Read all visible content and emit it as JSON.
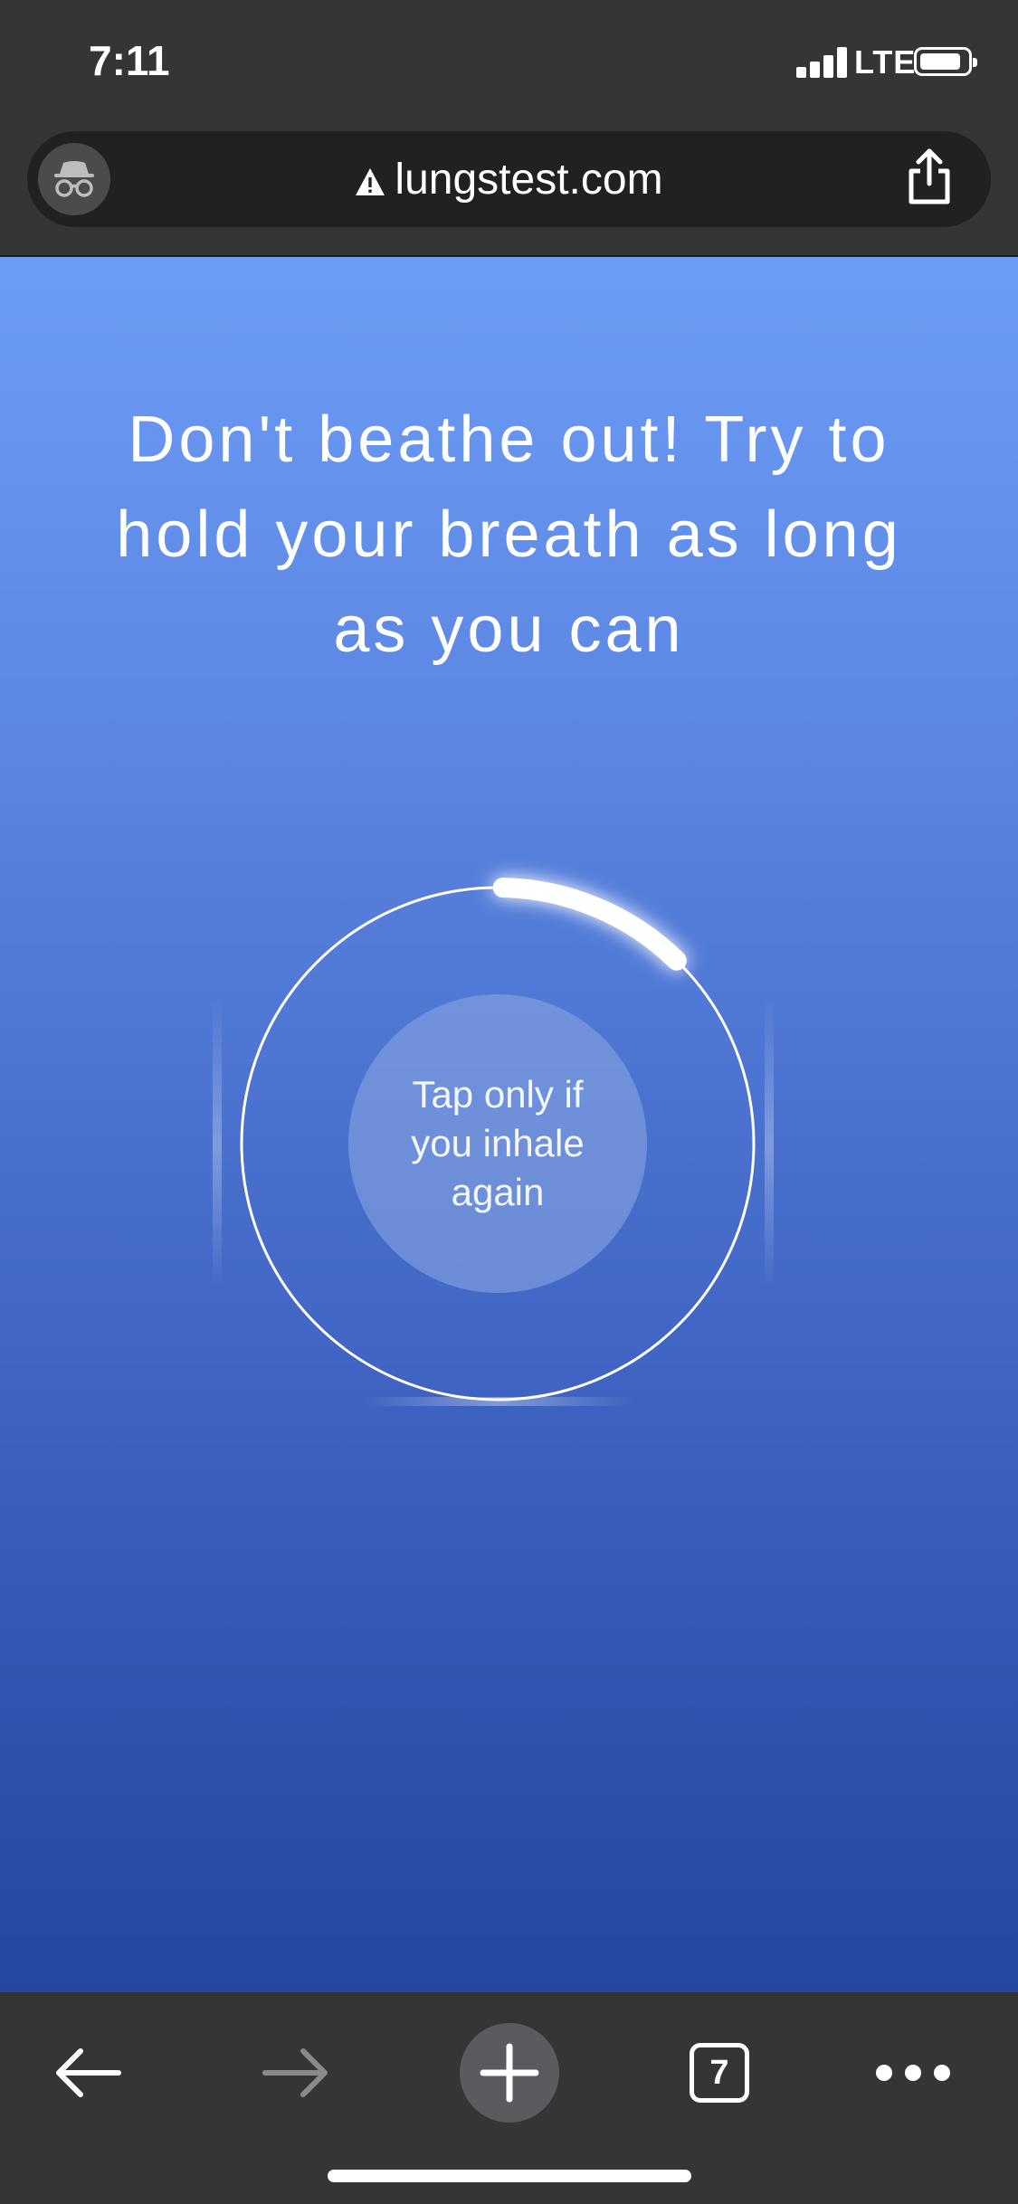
{
  "status_bar": {
    "time": "7:11",
    "network": "LTE"
  },
  "address_bar": {
    "url": "lungstest.com",
    "security_icon": "warning-triangle-icon",
    "left_icon": "incognito-icon",
    "right_icon": "share-icon"
  },
  "main": {
    "instruction": "Don't beathe out! Try to hold your breath as long as you can",
    "tap_button_label": "Tap only if you inhale again",
    "progress_fraction": 0.12
  },
  "toolbar": {
    "back_icon": "back-arrow-icon",
    "forward_icon": "forward-arrow-icon",
    "new_tab_icon": "plus-icon",
    "tab_count": "7",
    "menu_icon": "more-dots-icon"
  },
  "colors": {
    "chrome_bg": "#353538",
    "gradient_top": "#6c9cf5",
    "gradient_bottom": "#2447a3"
  }
}
